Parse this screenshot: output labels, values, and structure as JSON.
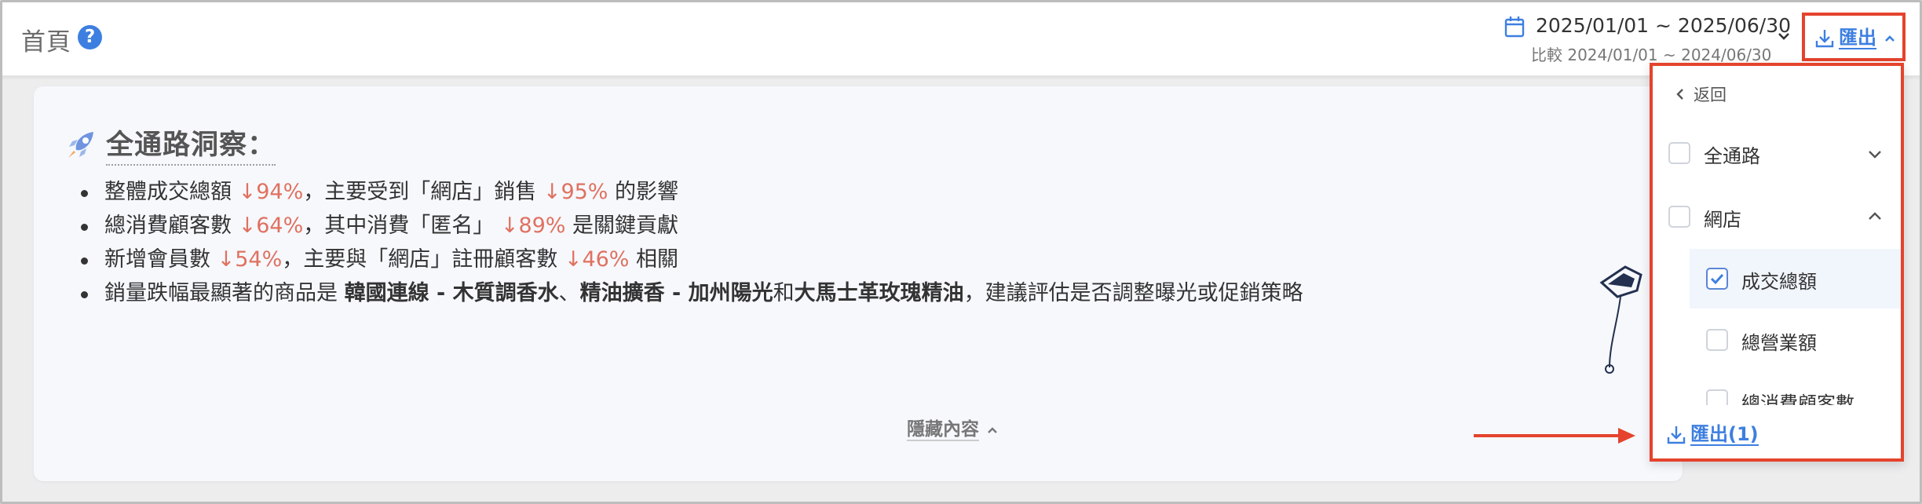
{
  "header": {
    "title": "首頁",
    "help_icon": "question-circle-icon",
    "date_range": "2025/01/01 ~ 2025/06/30",
    "compare_range": "比較 2024/01/01 ~ 2024/06/30",
    "export_label": "匯出"
  },
  "insight_card": {
    "title": "全通路洞察：",
    "icon": "rocket-icon",
    "lines": [
      {
        "parts": [
          {
            "text": "整體成交總額 ",
            "style": "normal"
          },
          {
            "text": "↓94%",
            "style": "neg"
          },
          {
            "text": "，主要受到「網店」銷售 ",
            "style": "normal"
          },
          {
            "text": "↓95%",
            "style": "neg"
          },
          {
            "text": " 的影響",
            "style": "normal"
          }
        ]
      },
      {
        "parts": [
          {
            "text": "總消費顧客數 ",
            "style": "normal"
          },
          {
            "text": "↓64%",
            "style": "neg"
          },
          {
            "text": "，其中消費「匿名」 ",
            "style": "normal"
          },
          {
            "text": "↓89%",
            "style": "neg"
          },
          {
            "text": " 是關鍵貢獻",
            "style": "normal"
          }
        ]
      },
      {
        "parts": [
          {
            "text": "新增會員數 ",
            "style": "normal"
          },
          {
            "text": "↓54%",
            "style": "neg"
          },
          {
            "text": "，主要與「網店」註冊顧客數 ",
            "style": "normal"
          },
          {
            "text": "↓46%",
            "style": "neg"
          },
          {
            "text": " 相關",
            "style": "normal"
          }
        ]
      },
      {
        "parts": [
          {
            "text": "銷量跌幅最顯著的商品是 ",
            "style": "normal"
          },
          {
            "text": "韓國連線 - 木質調香水",
            "style": "bold"
          },
          {
            "text": "、",
            "style": "normal"
          },
          {
            "text": "精油擴香 - 加州陽光",
            "style": "bold"
          },
          {
            "text": "和",
            "style": "normal"
          },
          {
            "text": "大馬士革玫瑰精油",
            "style": "bold"
          },
          {
            "text": "，建議評估是否調整曝光或促銷策略",
            "style": "normal"
          }
        ]
      }
    ],
    "hide_label": "隱藏內容"
  },
  "export_menu": {
    "back_label": "返回",
    "items": [
      {
        "label": "全通路",
        "checked": false,
        "expanded": false,
        "level": 0
      },
      {
        "label": "網店",
        "checked": false,
        "expanded": true,
        "level": 0
      },
      {
        "label": "成交總額",
        "checked": true,
        "level": 1
      },
      {
        "label": "總營業額",
        "checked": false,
        "level": 1
      },
      {
        "label": "總消費顧客數",
        "checked": false,
        "level": 1
      }
    ],
    "export_button_label": "匯出(1)"
  },
  "colors": {
    "accent": "#3d7fe0",
    "negative": "#e07160",
    "annotation": "#e5432d"
  }
}
